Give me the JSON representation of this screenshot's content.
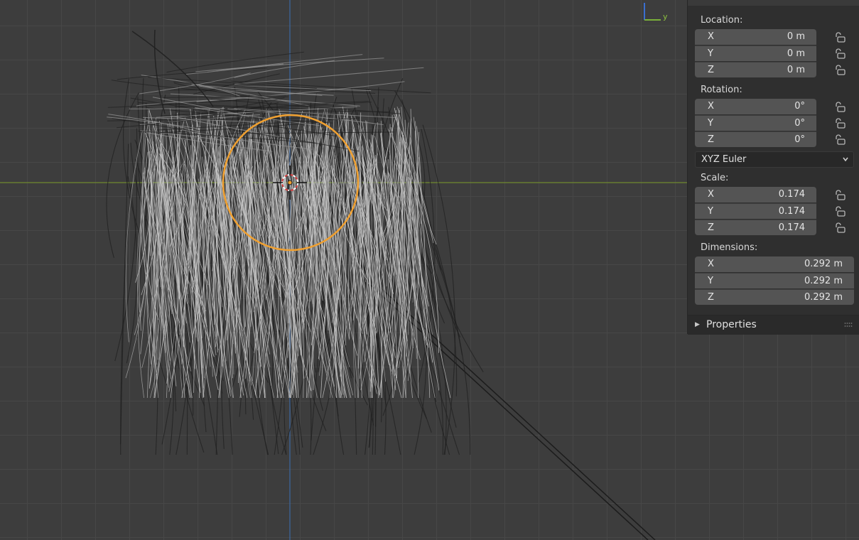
{
  "panel": {
    "location": {
      "label": "Location:",
      "x": {
        "axis": "X",
        "value": "0 m"
      },
      "y": {
        "axis": "Y",
        "value": "0 m"
      },
      "z": {
        "axis": "Z",
        "value": "0 m"
      }
    },
    "rotation": {
      "label": "Rotation:",
      "x": {
        "axis": "X",
        "value": "0°"
      },
      "y": {
        "axis": "Y",
        "value": "0°"
      },
      "z": {
        "axis": "Z",
        "value": "0°"
      }
    },
    "rotation_mode": "XYZ Euler",
    "scale": {
      "label": "Scale:",
      "x": {
        "axis": "X",
        "value": "0.174"
      },
      "y": {
        "axis": "Y",
        "value": "0.174"
      },
      "z": {
        "axis": "Z",
        "value": "0.174"
      }
    },
    "dimensions": {
      "label": "Dimensions:",
      "x": {
        "axis": "X",
        "value": "0.292 m"
      },
      "y": {
        "axis": "Y",
        "value": "0.292 m"
      },
      "z": {
        "axis": "Z",
        "value": "0.292 m"
      }
    },
    "properties_label": "Properties"
  },
  "gizmo": {
    "y_axis_label": "y"
  },
  "colors": {
    "x_axis_line": "#7a9a2a",
    "y_axis_line": "#3a6fb5",
    "selection_ring": "#f0a030",
    "hair_light": "#c8c8c8",
    "hair_dark": "#202020"
  },
  "icons": {
    "lock": "unlock-icon",
    "cursor": "3d-cursor-icon",
    "chevron": "chevron-down-icon",
    "properties_expand": "triangle-right-icon",
    "grip": "drag-grip-icon"
  }
}
